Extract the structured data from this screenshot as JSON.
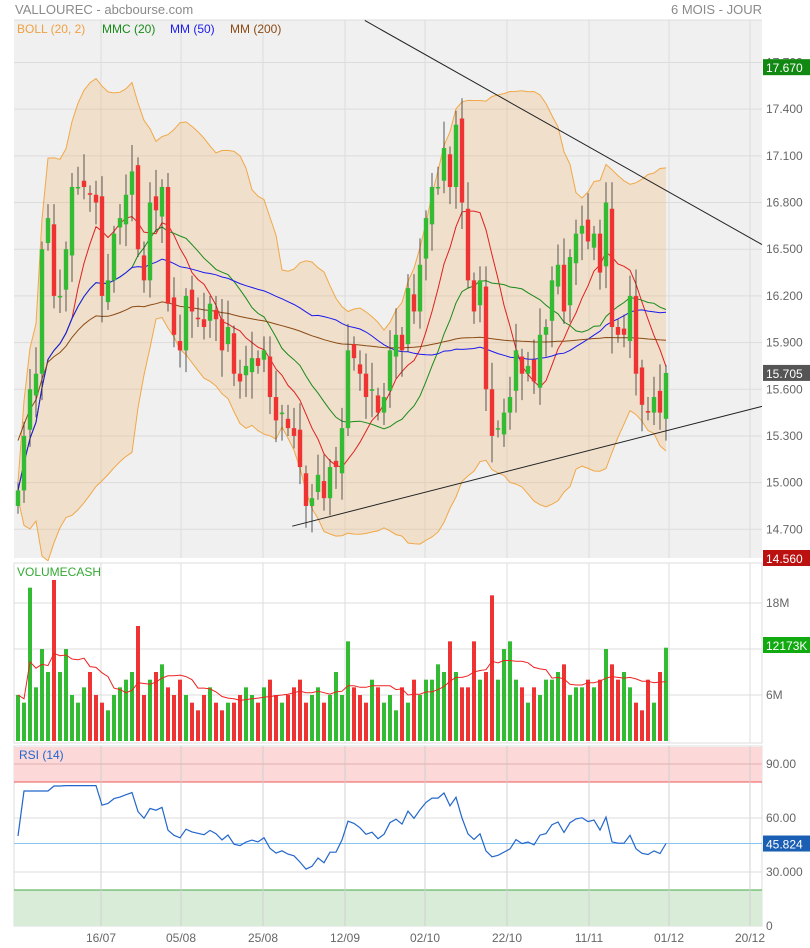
{
  "header": {
    "title": "VALLOUREC - abcbourse.com",
    "period": "6 MOIS - JOUR"
  },
  "legend": [
    {
      "label": "BOLL (20, 2)",
      "color": "#f0a040"
    },
    {
      "label": "MMC (20)",
      "color": "#1a8a1a"
    },
    {
      "label": "MM (50)",
      "color": "#1a1aee"
    },
    {
      "label": "MM (200)",
      "color": "#8b4a14"
    }
  ],
  "chart_data": [
    {
      "type": "candlestick",
      "title": "VALLOUREC",
      "x_tick_labels": [
        "16/07",
        "05/08",
        "25/08",
        "12/09",
        "02/10",
        "22/10",
        "11/11",
        "01/12",
        "20/12"
      ],
      "ylim": [
        14.56,
        17.95
      ],
      "y_tick_labels": [
        "17.700",
        "17.400",
        "17.100",
        "16.800",
        "16.500",
        "16.200",
        "15.900",
        "15.600",
        "15.300",
        "15.000",
        "14.700"
      ],
      "close": [
        14.95,
        15.3,
        15.6,
        15.7,
        16.5,
        16.7,
        16.2,
        16.2,
        16.5,
        16.9,
        16.9,
        16.9,
        16.85,
        16.8,
        16.2,
        16.3,
        16.6,
        16.7,
        16.85,
        17.0,
        16.5,
        16.3,
        16.8,
        16.75,
        16.9,
        16.15,
        15.95,
        15.85,
        16.2,
        16.1,
        16.05,
        16.0,
        16.15,
        16.05,
        15.85,
        16.0,
        15.7,
        15.65,
        15.75,
        15.8,
        15.75,
        15.85,
        15.55,
        15.4,
        15.45,
        15.35,
        15.3,
        15.1,
        14.85,
        14.9,
        15.05,
        14.9,
        15.1,
        15.1,
        15.35,
        15.85,
        15.8,
        15.7,
        15.55,
        15.6,
        15.45,
        15.55,
        15.85,
        15.95,
        15.85,
        16.25,
        16.1,
        16.4,
        16.7,
        16.9,
        16.9,
        17.15,
        16.9,
        17.3,
        16.8,
        16.3,
        16.1,
        16.3,
        15.6,
        15.3,
        15.35,
        15.45,
        15.55,
        15.85,
        15.7,
        15.75,
        15.65,
        15.95,
        16.0,
        16.3,
        16.4,
        16.1,
        16.45,
        16.6,
        16.65,
        16.55,
        16.6,
        16.35,
        16.8,
        16.0,
        15.95,
        15.95,
        16.2,
        15.7,
        15.5,
        15.45,
        15.55,
        15.45,
        15.705
      ],
      "trendlines": [
        {
          "name": "resistance",
          "from": {
            "index": 57.8,
            "price": 17.97
          },
          "to": {
            "index": 124,
            "price": 16.53
          }
        },
        {
          "name": "support",
          "from": {
            "index": 45.7,
            "price": 14.72
          },
          "to": {
            "index": 124,
            "price": 15.49
          }
        }
      ],
      "badges": {
        "high": "17.670",
        "last": "15.705",
        "low": "14.560"
      },
      "colors": {
        "up": "#33bb33",
        "down": "#ee3333",
        "high": "#118811",
        "last": "#555555",
        "low": "#bb1111"
      }
    },
    {
      "type": "bar",
      "title": "VOLUMECASH",
      "unit": "M",
      "ylim": [
        0,
        22
      ],
      "y_tick_labels": [
        "18M",
        "6M"
      ],
      "values": [
        6,
        5,
        20,
        7,
        12,
        9,
        21,
        9,
        12,
        6,
        5,
        7,
        9,
        6,
        5,
        4,
        6,
        7,
        8,
        9,
        15,
        6,
        8,
        9,
        10,
        7,
        6,
        8,
        6,
        5,
        4,
        6,
        7,
        5,
        4,
        5,
        5,
        6,
        7,
        6,
        5,
        7,
        8,
        6,
        5,
        6,
        7,
        8,
        5,
        6,
        7,
        5,
        6,
        9,
        6,
        13,
        7,
        6,
        5,
        8,
        7,
        5,
        6,
        4,
        7,
        5,
        8,
        6,
        8,
        8,
        10,
        9,
        13,
        9,
        7,
        7,
        13,
        8,
        9,
        19,
        8,
        12,
        13,
        8,
        7,
        5,
        7,
        6,
        8,
        8,
        9,
        10,
        6,
        7,
        7,
        8,
        7,
        8,
        12,
        10,
        8,
        9,
        7,
        5,
        4,
        8,
        5,
        9,
        12.17
      ],
      "badge": "12173K",
      "avg_label_color": "#ee2222"
    },
    {
      "type": "line",
      "title": "RSI (14)",
      "ylim": [
        0,
        100
      ],
      "y_tick_labels": [
        "90.00",
        "60.00",
        "30.000",
        "0"
      ],
      "overbought": 80,
      "oversold": 20,
      "badge": "45.824"
    }
  ]
}
